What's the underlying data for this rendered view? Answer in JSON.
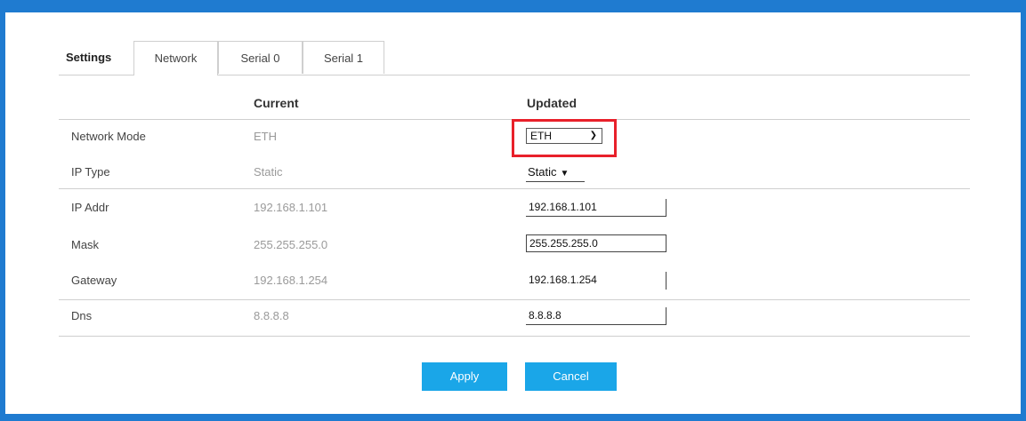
{
  "tabs": {
    "settings": "Settings",
    "network": "Network",
    "serial0": "Serial 0",
    "serial1": "Serial 1"
  },
  "headers": {
    "current": "Current",
    "updated": "Updated"
  },
  "rows": [
    {
      "label": "Network Mode",
      "current": "ETH",
      "updated": "ETH"
    },
    {
      "label": "IP Type",
      "current": "Static",
      "updated": "Static"
    },
    {
      "label": "IP Addr",
      "current": "192.168.1.101",
      "updated": "192.168.1.101"
    },
    {
      "label": "Mask",
      "current": "255.255.255.0",
      "updated": "255.255.255.0"
    },
    {
      "label": "Gateway",
      "current": "192.168.1.254",
      "updated": "192.168.1.254"
    },
    {
      "label": "Dns",
      "current": "8.8.8.8",
      "updated": "8.8.8.8"
    }
  ],
  "buttons": {
    "apply": "Apply",
    "cancel": "Cancel"
  },
  "colors": {
    "frame": "#1f7bd0",
    "button": "#1aa6e8",
    "highlight": "#e8202a"
  },
  "icons": {
    "dropdown": "chevron-down-icon"
  }
}
